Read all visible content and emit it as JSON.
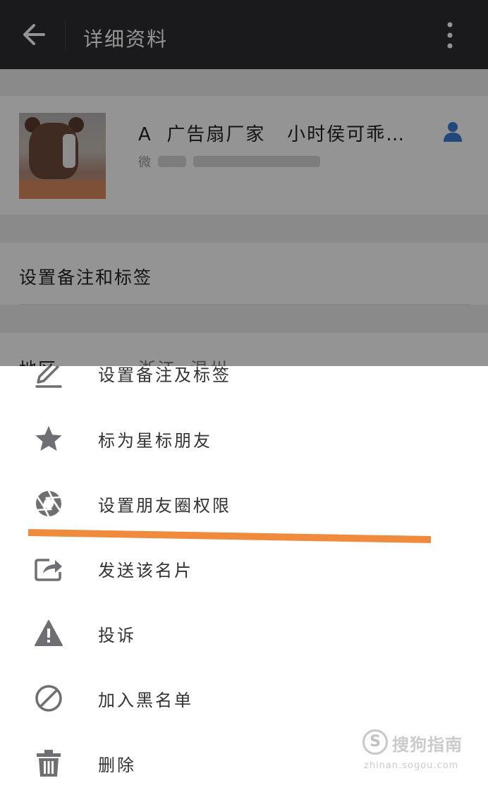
{
  "header": {
    "title": "详细资料"
  },
  "profile": {
    "name": "A  广告扇厂家   小时侯可乖…",
    "account_label": "微"
  },
  "remark_row": {
    "label": "设置备注和标签"
  },
  "region_row": {
    "label": "地区",
    "value": "浙江  温州"
  },
  "menu": {
    "items": [
      {
        "label": "设置备注及标签",
        "icon": "edit-icon"
      },
      {
        "label": "标为星标朋友",
        "icon": "star-icon"
      },
      {
        "label": "设置朋友圈权限",
        "icon": "aperture-icon"
      },
      {
        "label": "发送该名片",
        "icon": "share-icon"
      },
      {
        "label": "投诉",
        "icon": "warning-icon"
      },
      {
        "label": "加入黑名单",
        "icon": "block-icon"
      },
      {
        "label": "删除",
        "icon": "trash-icon"
      }
    ]
  },
  "watermark": {
    "text": "搜狗指南",
    "url": "zhinan.sogou.com"
  },
  "colors": {
    "topbar": "#2e2e31",
    "icon_gray": "#6f6f73",
    "highlight_stroke": "#f08a3c",
    "contact_icon": "#3a7bd5"
  }
}
